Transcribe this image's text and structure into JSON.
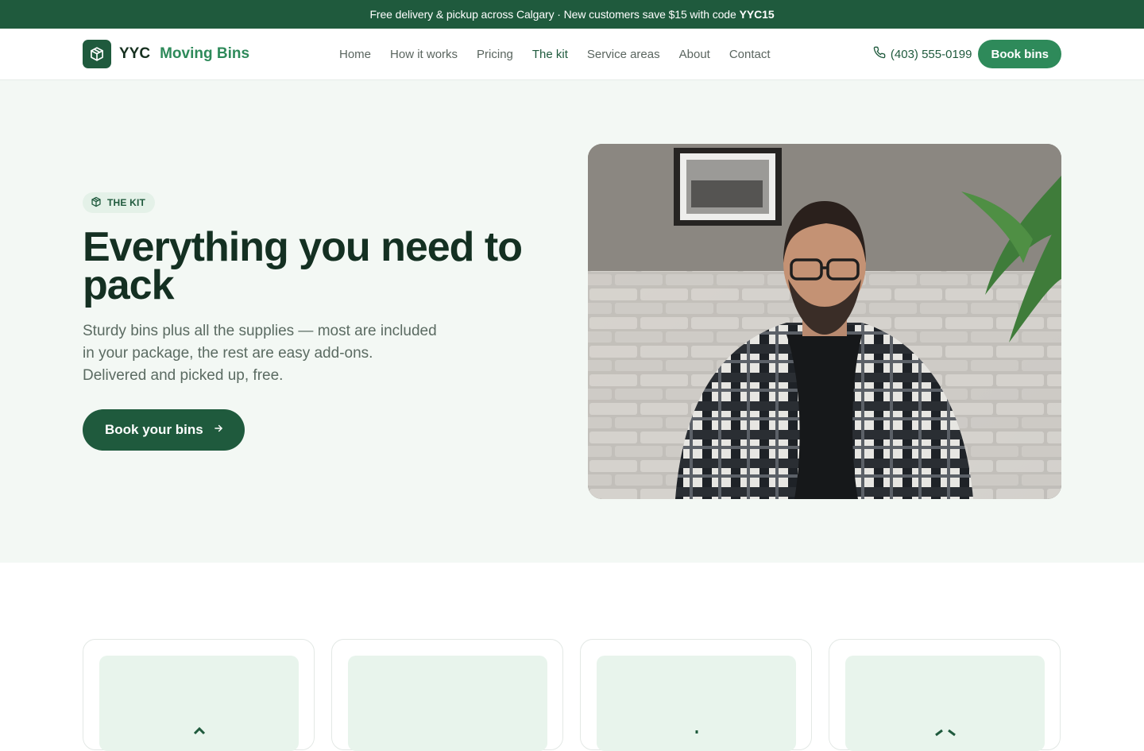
{
  "promo": {
    "text": "Free delivery & pickup across Calgary · New customers save $15 with code",
    "code": "YYC15"
  },
  "nav": {
    "brand_prefix": "YYC",
    "brand_name": "Moving Bins",
    "links": [
      "Home",
      "How it works",
      "Pricing",
      "The kit",
      "Service areas",
      "About",
      "Contact"
    ],
    "active_link": "The kit",
    "phone": "(403) 555-0199",
    "cta_label": "Book bins"
  },
  "hero": {
    "badge": "THE KIT",
    "title": "Everything you need to pack",
    "subtitle": "Sturdy bins plus all the supplies — most are included in your package, the rest are easy add-ons. Delivered and picked up, free.",
    "cta_label": "Book your bins"
  },
  "colors": {
    "primary": "#1f5a3d",
    "accent": "#2e8a5a",
    "hero_bg": "#f3f8f4"
  },
  "icons": [
    "box-icon",
    "phone-icon",
    "arrow-right-icon"
  ]
}
